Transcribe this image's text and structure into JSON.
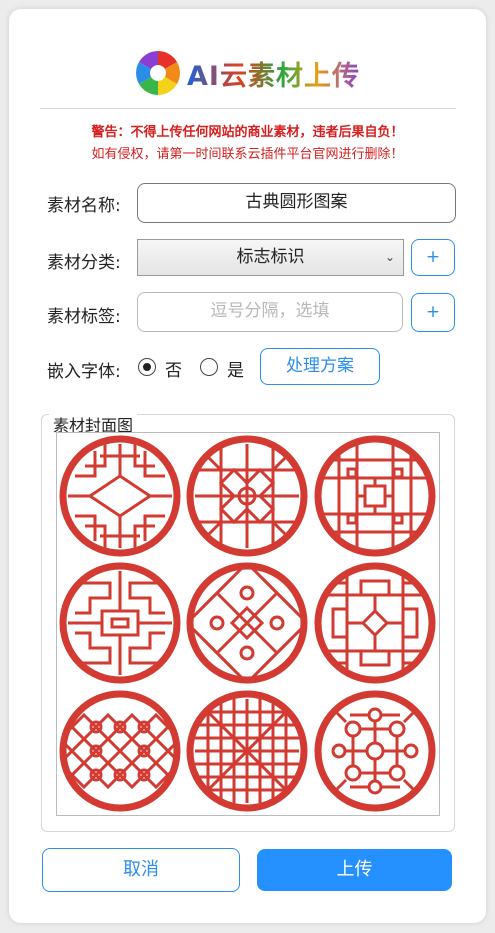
{
  "header": {
    "logo_text": "AI云素材上传",
    "logo_icon": "rainbow-aperture-icon"
  },
  "warning": {
    "line1": "警告：不得上传任何网站的商业素材，违者后果自负！",
    "line2": "如有侵权，请第一时间联系云插件平台官网进行删除！",
    "color": "#d81e1e"
  },
  "form": {
    "name_label": "素材名称:",
    "name_value": "古典圆形图案",
    "category_label": "素材分类:",
    "category_value": "标志标识",
    "add_category_label": "+",
    "tags_label": "素材标签:",
    "tags_placeholder": "逗号分隔，选填",
    "add_tag_label": "+",
    "embed_font_label": "嵌入字体:",
    "embed_no_label": "否",
    "embed_yes_label": "是",
    "embed_selected": "否",
    "plan_button_label": "处理方案",
    "cover_legend": "素材封面图",
    "cover_icon": "chinese-lattice-pattern-grid",
    "pattern_color": "#d23a32"
  },
  "actions": {
    "cancel_label": "取消",
    "upload_label": "上传",
    "accent_color": "#2590ff"
  }
}
